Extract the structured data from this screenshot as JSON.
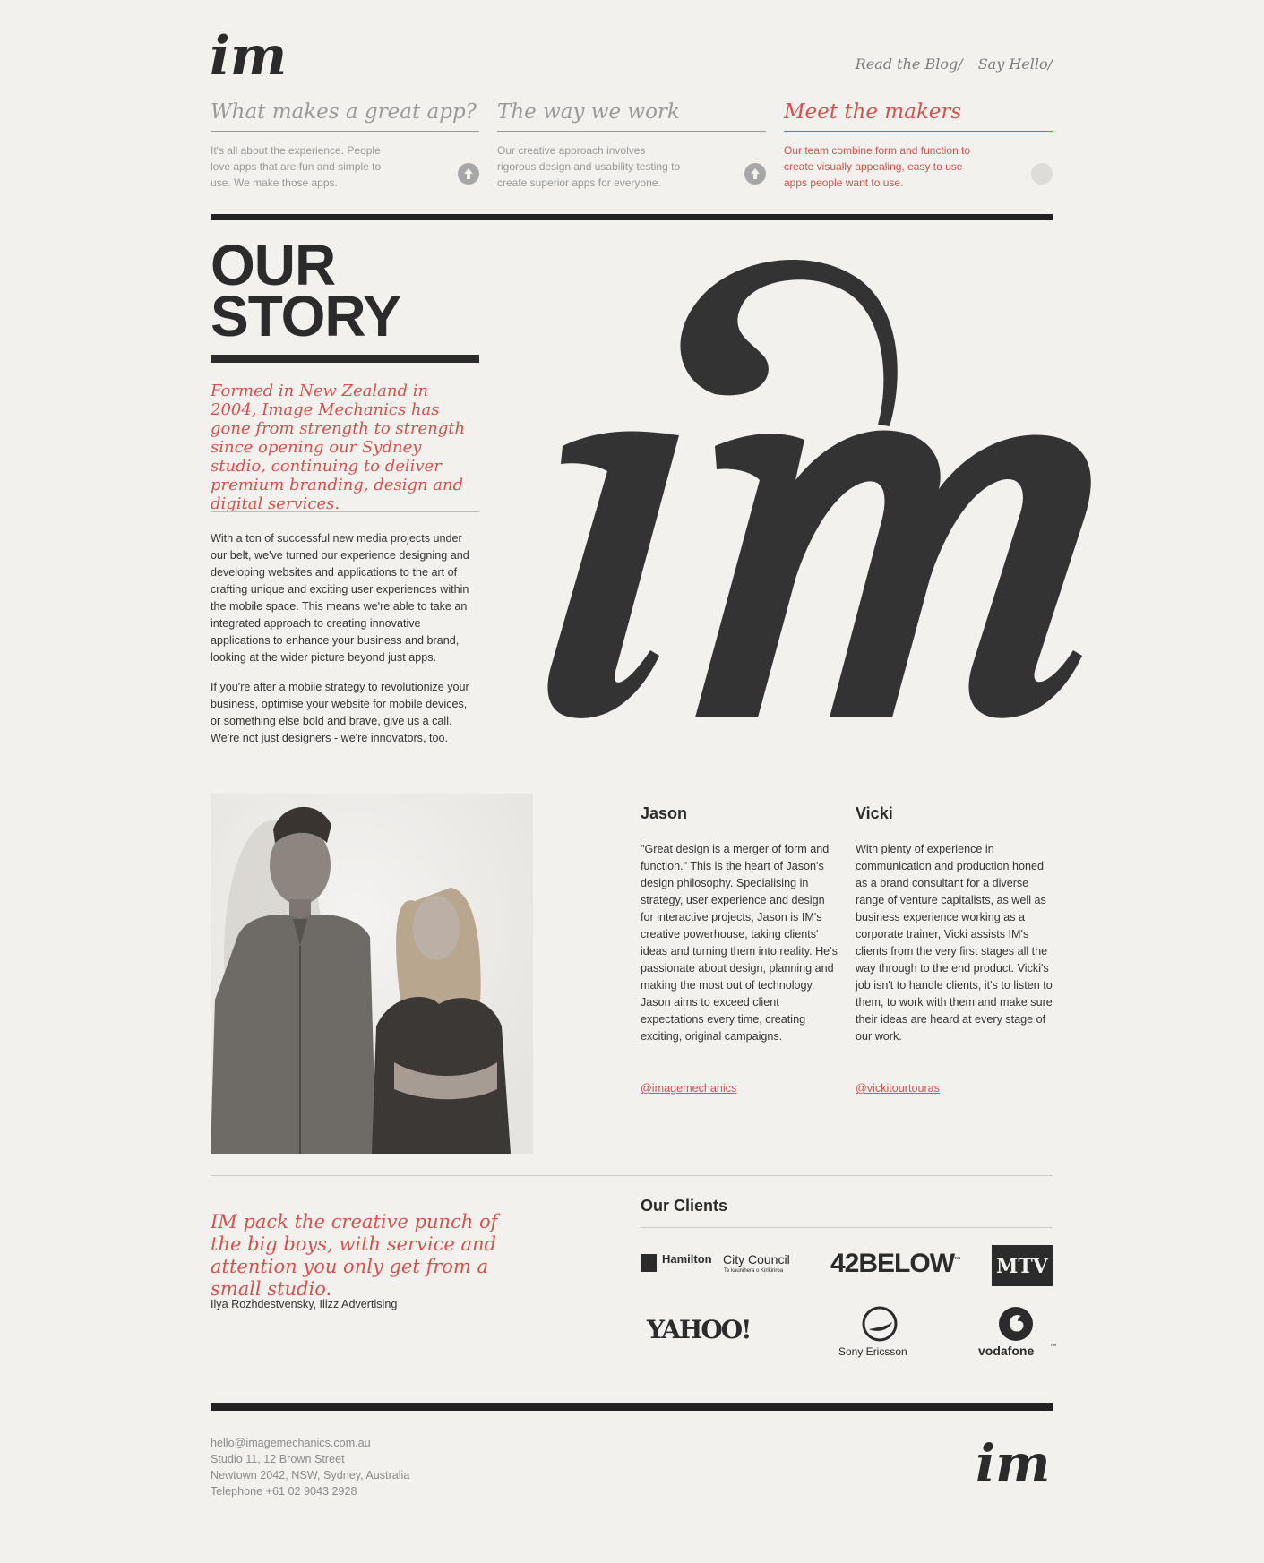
{
  "header": {
    "logo_text": "im",
    "links": [
      "Read the Blog/",
      "Say Hello/"
    ]
  },
  "nav": [
    {
      "title": "What makes a great app?",
      "text": "It's all about the experience. People love apps that are fun and simple to use. We make those apps.",
      "icon": "arrow-up-icon",
      "active": false
    },
    {
      "title": "The way we work",
      "text": "Our creative approach involves rigorous design and usability testing to create superior apps for everyone.",
      "icon": "arrow-up-icon",
      "active": false
    },
    {
      "title": "Meet the makers",
      "text": "Our team combine form and function to create visually appealing, easy to use apps people want to use.",
      "icon": "circle-icon",
      "active": true
    }
  ],
  "story": {
    "title_line1": "OUR",
    "title_line2": "STORY",
    "lead": "Formed in New Zealand in 2004, Image Mechanics has gone from strength to strength since opening our Sydney studio, continuing to deliver premium branding, design and digital services.",
    "paragraph1": "With a ton of successful new media projects under our belt, we've turned our experience designing and developing websites and applications to the art of crafting unique and exciting user experiences within the mobile space. This means we're able to take an integrated approach to creating innovative applications to enhance your business and brand, looking at the wider picture beyond just apps.",
    "paragraph2": "If you're after a mobile strategy to revolutionize your business, optimise your website for mobile devices, or something else bold and brave, give us a call. We're not just designers - we're innovators, too."
  },
  "people": [
    {
      "name": "Jason",
      "bio": "\"Great design is a merger of form and function.\" This is the heart of Jason's design philosophy. Specialising in strategy, user experience and design for interactive projects, Jason is IM's creative powerhouse, taking clients' ideas and turning them into reality. He's passionate about design, planning and making the most out of technology. Jason aims to exceed client expectations every time, creating exciting, original campaigns.",
      "handle": "@imagemechanics"
    },
    {
      "name": "Vicki",
      "bio": "With plenty of experience in communication and production honed as a brand consultant for a diverse range of venture capitalists, as well as business experience working as a corporate trainer, Vicki assists IM's clients from the very first stages all the way through to the end product. Vicki's job isn't to handle clients, it's to listen to them, to work with them and make sure their ideas are heard at every stage of our work.",
      "handle": "@vickitourtouras"
    }
  ],
  "testimonial": {
    "quote": "IM pack the creative punch of the big boys, with service and attention you only get from a small studio.",
    "cite": "Ilya Rozhdestvensky, Ilizz Advertising"
  },
  "clients": {
    "title": "Our Clients",
    "logos": [
      {
        "name": "Hamilton City Council",
        "word1": "Hamilton",
        "word2": "City Council",
        "sub": "Te kaunihera o Kirikiriroa"
      },
      {
        "name": "42BELOW",
        "text": "42BELOW",
        "tm": "™"
      },
      {
        "name": "MTV",
        "text": "MTV"
      },
      {
        "name": "Yahoo",
        "text": "YAHOO!"
      },
      {
        "name": "Sony Ericsson",
        "text": "Sony Ericsson"
      },
      {
        "name": "Vodafone",
        "text": "vodafone",
        "tm": "™"
      }
    ]
  },
  "footer": {
    "email": "hello@imagemechanics.com.au",
    "address1": "Studio 11, 12 Brown Street",
    "address2": "Newtown 2042, NSW, Sydney, Australia",
    "phone": "Telephone +61 02 9043 2928",
    "logo_text": "im"
  },
  "colors": {
    "accent": "#d9504c",
    "dark": "#2b2b2b",
    "background": "#f2f1ee",
    "muted": "#999999"
  }
}
